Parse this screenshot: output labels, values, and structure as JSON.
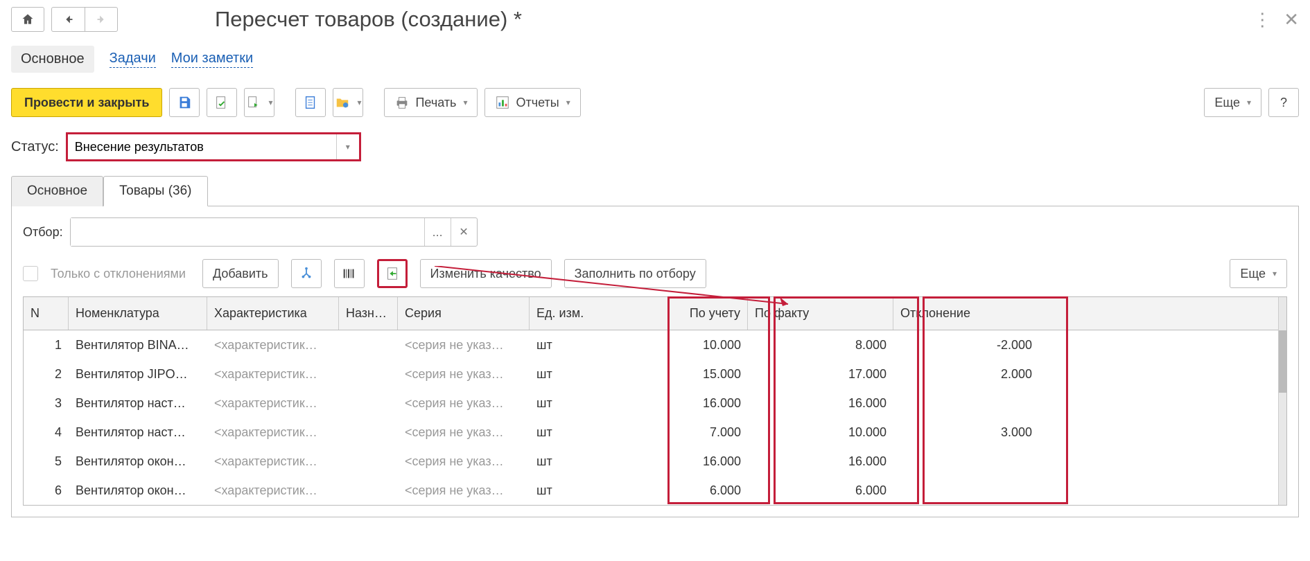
{
  "header": {
    "title": "Пересчет товаров (создание) *"
  },
  "link_tabs": {
    "main": "Основное",
    "tasks": "Задачи",
    "notes": "Мои заметки"
  },
  "toolbar": {
    "post_close": "Провести и закрыть",
    "print": "Печать",
    "reports": "Отчеты",
    "more": "Еще",
    "help": "?"
  },
  "status": {
    "label": "Статус:",
    "value": "Внесение результатов"
  },
  "page_tabs": {
    "main": "Основное",
    "goods": "Товары (36)"
  },
  "filter": {
    "label": "Отбор:",
    "dots": "..."
  },
  "grid_toolbar": {
    "only_dev": "Только с отклонениями",
    "add": "Добавить",
    "change_quality": "Изменить качество",
    "fill_by_filter": "Заполнить по отбору",
    "more": "Еще"
  },
  "columns": {
    "n": "N",
    "nom": "Номенклатура",
    "char": "Характеристика",
    "nazn": "Назн…",
    "ser": "Серия",
    "um": "Ед. изм.",
    "uch": "По учету",
    "fact": "По факту",
    "dev": "Отклонение"
  },
  "placeholders": {
    "char": "<характеристик…",
    "ser": "<серия не указ…"
  },
  "rows": [
    {
      "n": "1",
      "nom": "Вентилятор BINA…",
      "um": "шт",
      "uch": "10.000",
      "fact": "8.000",
      "dev": "-2.000"
    },
    {
      "n": "2",
      "nom": "Вентилятор JIPO…",
      "um": "шт",
      "uch": "15.000",
      "fact": "17.000",
      "dev": "2.000"
    },
    {
      "n": "3",
      "nom": "Вентилятор наст…",
      "um": "шт",
      "uch": "16.000",
      "fact": "16.000",
      "dev": ""
    },
    {
      "n": "4",
      "nom": "Вентилятор наст…",
      "um": "шт",
      "uch": "7.000",
      "fact": "10.000",
      "dev": "3.000"
    },
    {
      "n": "5",
      "nom": "Вентилятор окон…",
      "um": "шт",
      "uch": "16.000",
      "fact": "16.000",
      "dev": ""
    },
    {
      "n": "6",
      "nom": "Вентилятор окон…",
      "um": "шт",
      "uch": "6.000",
      "fact": "6.000",
      "dev": ""
    }
  ]
}
